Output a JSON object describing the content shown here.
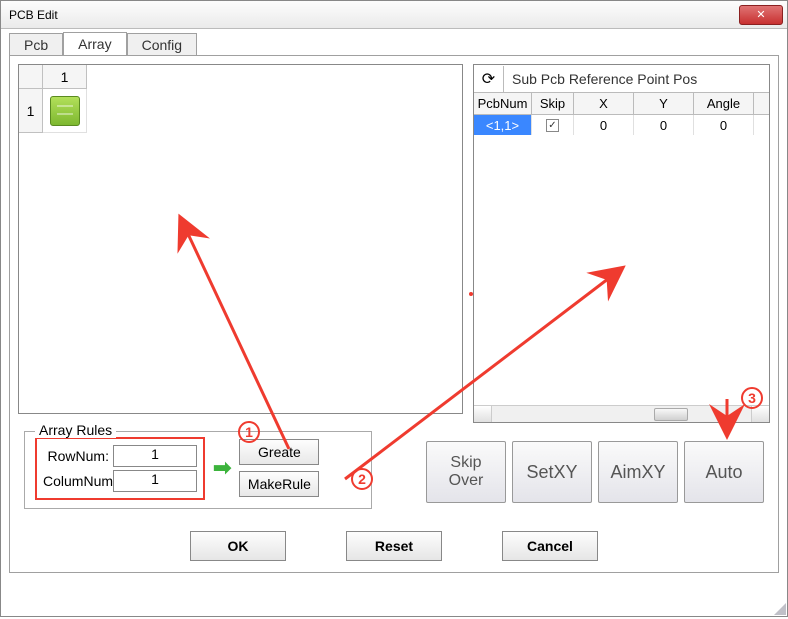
{
  "window": {
    "title": "PCB Edit"
  },
  "tabs": {
    "pcb": "Pcb",
    "array": "Array",
    "config": "Config",
    "active": "array"
  },
  "left_grid": {
    "col_header": "1",
    "row_header": "1"
  },
  "right_panel": {
    "title": "Sub Pcb Reference Point Pos",
    "headers": {
      "pcbnum": "PcbNum",
      "skip": "Skip",
      "x": "X",
      "y": "Y",
      "angle": "Angle"
    },
    "row": {
      "pcbnum": "<1,1>",
      "skip_checked": true,
      "x": "0",
      "y": "0",
      "angle": "0"
    }
  },
  "rules": {
    "legend": "Array Rules",
    "rownum_label": "RowNum:",
    "rownum_value": "1",
    "colnum_label": "ColumNum:",
    "colnum_value": "1",
    "greate": "Greate",
    "makerule": "MakeRule"
  },
  "buttons": {
    "skipover": "Skip\nOver",
    "setxy": "SetXY",
    "aimxy": "AimXY",
    "auto": "Auto",
    "ok": "OK",
    "reset": "Reset",
    "cancel": "Cancel"
  },
  "annotations": {
    "c1": "1",
    "c2": "2",
    "c3": "3"
  }
}
